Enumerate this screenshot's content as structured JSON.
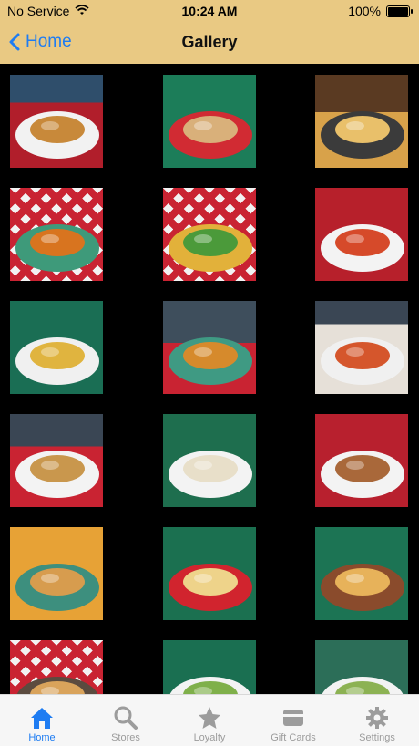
{
  "status_bar": {
    "carrier": "No Service",
    "time": "10:24 AM",
    "battery": "100%"
  },
  "nav": {
    "back_label": "Home",
    "title": "Gallery"
  },
  "gallery": {
    "items": [
      {
        "name": "burger-photo"
      },
      {
        "name": "wrap-sandwich-photo"
      },
      {
        "name": "pizza-photo"
      },
      {
        "name": "wings-photo"
      },
      {
        "name": "salad-photo"
      },
      {
        "name": "lasagna-photo"
      },
      {
        "name": "nachos-photo"
      },
      {
        "name": "onion-rings-photo"
      },
      {
        "name": "pepperoni-pizza-photo"
      },
      {
        "name": "sub-sandwich-photo"
      },
      {
        "name": "pasta-photo"
      },
      {
        "name": "cheesesteak-photo"
      },
      {
        "name": "calzone-photo"
      },
      {
        "name": "garlic-knots-photo"
      },
      {
        "name": "thin-pizza-photo"
      },
      {
        "name": "pizza-slice-photo"
      },
      {
        "name": "caesar-salad-photo"
      },
      {
        "name": "chicken-salad-photo"
      }
    ]
  },
  "tabs": [
    {
      "label": "Home",
      "icon": "home-icon",
      "active": true
    },
    {
      "label": "Stores",
      "icon": "search-icon",
      "active": false
    },
    {
      "label": "Loyalty",
      "icon": "star-icon",
      "active": false
    },
    {
      "label": "Gift Cards",
      "icon": "gift-card-icon",
      "active": false
    },
    {
      "label": "Settings",
      "icon": "gear-icon",
      "active": false
    }
  ],
  "colors": {
    "header_bg": "#E9C983",
    "accent": "#1E7CF2",
    "inactive": "#9C9C9C"
  }
}
